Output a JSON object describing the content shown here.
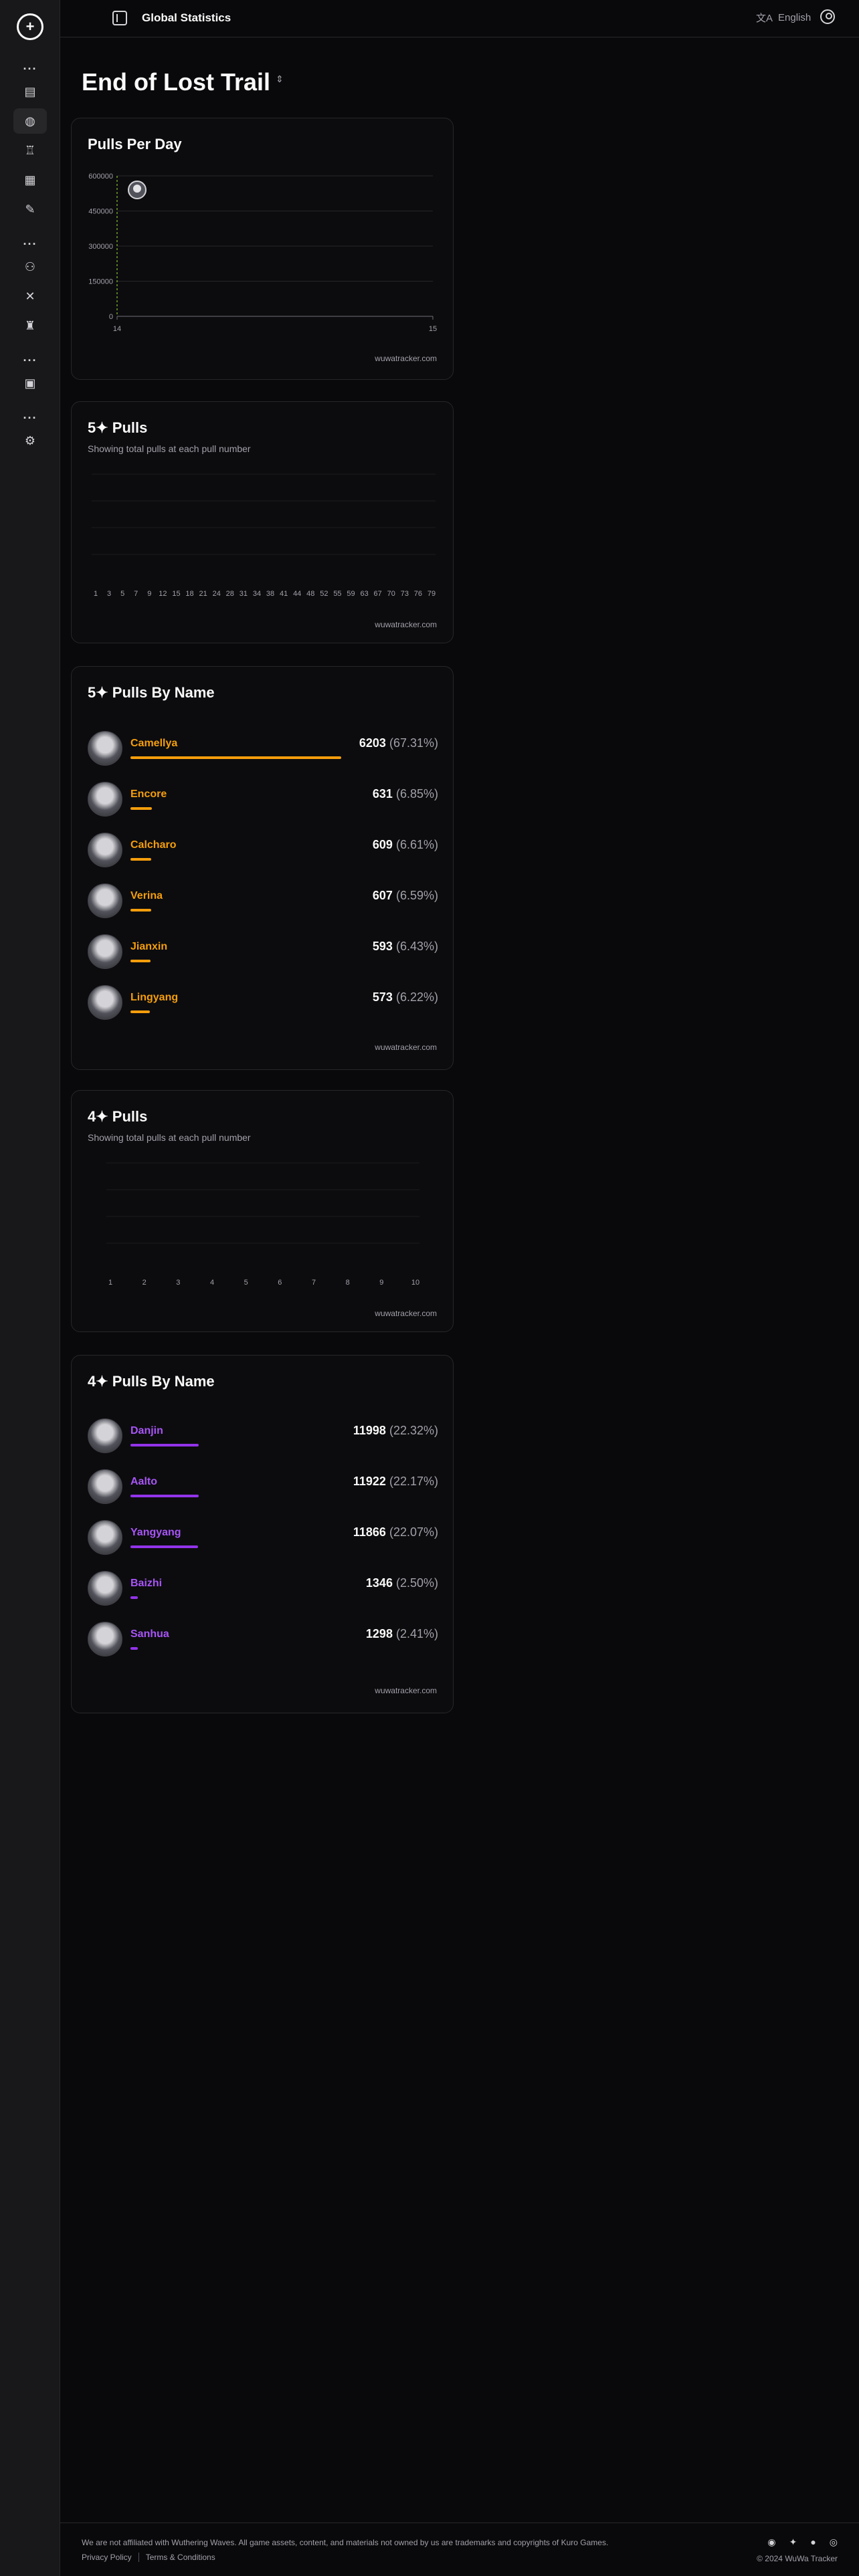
{
  "topbar": {
    "title": "Global Statistics",
    "language": "English"
  },
  "page": {
    "title": "End of Lost Trail"
  },
  "pulls_per_day": {
    "title": "Pulls Per Day",
    "watermark": "wuwatracker.com",
    "y_ticks": [
      "600000",
      "450000",
      "300000",
      "150000",
      "0"
    ],
    "x_ticks": [
      "14",
      "15"
    ],
    "chart_data": {
      "type": "line",
      "x": [
        "14",
        "15"
      ],
      "ylim": [
        0,
        600000
      ],
      "grid": true,
      "series": [
        {
          "values": [
            540000,
            null
          ]
        }
      ]
    }
  },
  "five_star_pulls": {
    "title": "5✦ Pulls",
    "subtitle": "Showing total pulls at each pull number",
    "watermark": "wuwatracker.com",
    "x_ticks": [
      "1",
      "3",
      "5",
      "7",
      "9",
      "12",
      "15",
      "18",
      "21",
      "24",
      "28",
      "31",
      "34",
      "38",
      "41",
      "44",
      "48",
      "52",
      "55",
      "59",
      "63",
      "67",
      "70",
      "73",
      "76",
      "79"
    ],
    "chart_data": {
      "type": "bar",
      "categories": [
        "1",
        "3",
        "5",
        "7",
        "9",
        "12",
        "15",
        "18",
        "21",
        "24",
        "28",
        "31",
        "34",
        "38",
        "41",
        "44",
        "48",
        "52",
        "55",
        "59",
        "63",
        "67",
        "70",
        "73",
        "76",
        "79"
      ],
      "values": []
    }
  },
  "five_star_by_name": {
    "title": "5✦ Pulls By Name",
    "watermark": "wuwatracker.com",
    "accent": "#f59e0b",
    "rows": [
      {
        "name": "Camellya",
        "count": "6203",
        "pct": "(67.31%)",
        "share": 0.6731
      },
      {
        "name": "Encore",
        "count": "631",
        "pct": "(6.85%)",
        "share": 0.0685
      },
      {
        "name": "Calcharo",
        "count": "609",
        "pct": "(6.61%)",
        "share": 0.0661
      },
      {
        "name": "Verina",
        "count": "607",
        "pct": "(6.59%)",
        "share": 0.0659
      },
      {
        "name": "Jianxin",
        "count": "593",
        "pct": "(6.43%)",
        "share": 0.0643
      },
      {
        "name": "Lingyang",
        "count": "573",
        "pct": "(6.22%)",
        "share": 0.0622
      }
    ]
  },
  "four_star_pulls": {
    "title": "4✦ Pulls",
    "subtitle": "Showing total pulls at each pull number",
    "watermark": "wuwatracker.com",
    "x_ticks": [
      "1",
      "2",
      "3",
      "4",
      "5",
      "6",
      "7",
      "8",
      "9",
      "10"
    ],
    "chart_data": {
      "type": "bar",
      "categories": [
        "1",
        "2",
        "3",
        "4",
        "5",
        "6",
        "7",
        "8",
        "9",
        "10"
      ],
      "values": []
    }
  },
  "four_star_by_name": {
    "title": "4✦ Pulls By Name",
    "watermark": "wuwatracker.com",
    "accent": "#a855f7",
    "rows": [
      {
        "name": "Danjin",
        "count": "11998",
        "pct": "(22.32%)",
        "share": 0.2232
      },
      {
        "name": "Aalto",
        "count": "11922",
        "pct": "(22.17%)",
        "share": 0.2217
      },
      {
        "name": "Yangyang",
        "count": "11866",
        "pct": "(22.07%)",
        "share": 0.2207
      },
      {
        "name": "Baizhi",
        "count": "1346",
        "pct": "(2.50%)",
        "share": 0.025
      },
      {
        "name": "Sanhua",
        "count": "1298",
        "pct": "(2.41%)",
        "share": 0.0241
      }
    ]
  },
  "footer": {
    "disclaimer": "We are not affiliated with Wuthering Waves. All game assets, content, and materials not owned by us are trademarks and copyrights of Kuro Games.",
    "privacy": "Privacy Policy",
    "terms": "Terms & Conditions",
    "copyright": "© 2024 WuWa Tracker"
  }
}
